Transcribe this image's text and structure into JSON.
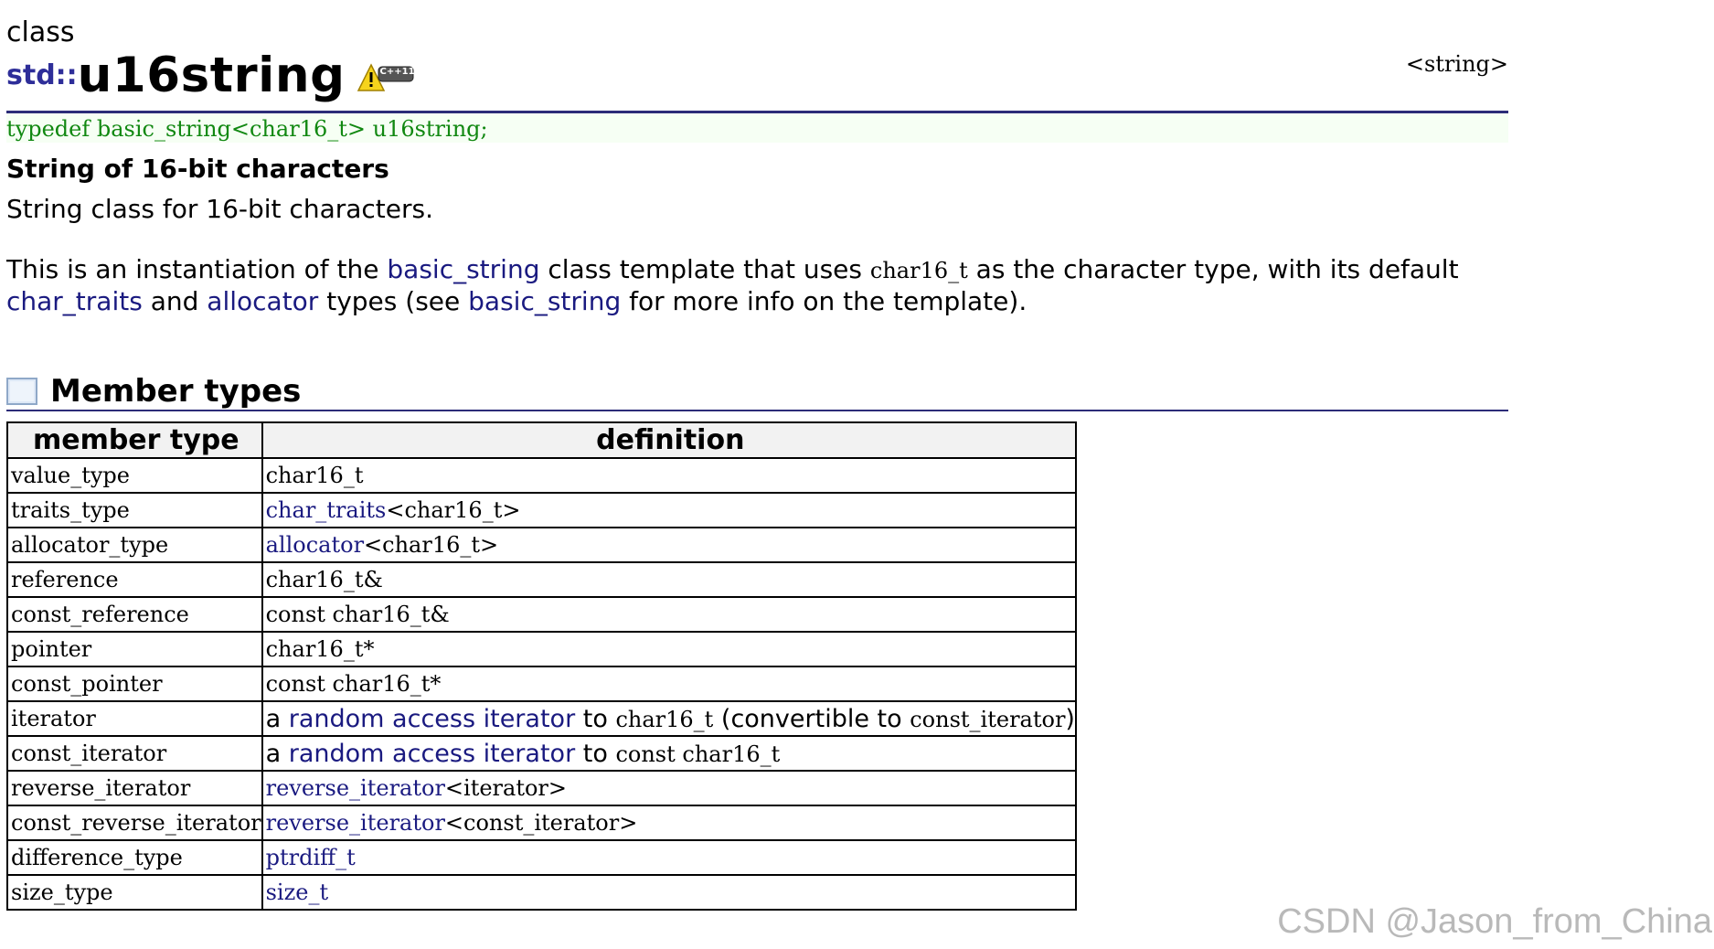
{
  "page": {
    "kind": "class",
    "namespace": "std::",
    "class_name": "u16string",
    "header": "<string>",
    "badge_text": "C++11",
    "typedef": "typedef basic_string<char16_t> u16string;",
    "subtitle": "String of 16-bit characters",
    "summary": "String class for 16-bit characters.",
    "desc": {
      "t1": "This is an instantiation of the ",
      "l1": "basic_string",
      "t2": " class template that uses ",
      "c1": "char16_t",
      "t3": " as the character type, with its default ",
      "l2": "char_traits",
      "t4": " and ",
      "l3": "allocator",
      "t5": " types (see ",
      "l4": "basic_string",
      "t6": " for more info on the template)."
    }
  },
  "section": {
    "title": "Member types",
    "icon": "table-icon"
  },
  "table": {
    "headers": [
      "member type",
      "definition"
    ],
    "rows": [
      {
        "type": "value_type",
        "def": {
          "code": "char16_t"
        }
      },
      {
        "type": "traits_type",
        "def": {
          "link": "char_traits",
          "rest": "<char16_t>"
        }
      },
      {
        "type": "allocator_type",
        "def": {
          "link": "allocator",
          "rest": "<char16_t>"
        }
      },
      {
        "type": "reference",
        "def": {
          "code": "char16_t&"
        }
      },
      {
        "type": "const_reference",
        "def": {
          "code": "const char16_t&"
        }
      },
      {
        "type": "pointer",
        "def": {
          "code": "char16_t*"
        }
      },
      {
        "type": "const_pointer",
        "def": {
          "code": "const char16_t*"
        }
      },
      {
        "type": "iterator",
        "def": {
          "a": "a ",
          "link": "random access iterator",
          "b": " to ",
          "code1": "char16_t",
          "c": " (convertible to ",
          "code2": "const_iterator",
          "d": ")"
        }
      },
      {
        "type": "const_iterator",
        "def": {
          "a": "a ",
          "link": "random access iterator",
          "b": " to ",
          "code1": "const char16_t"
        }
      },
      {
        "type": "reverse_iterator",
        "def": {
          "link": "reverse_iterator",
          "rest": "<iterator>"
        }
      },
      {
        "type": "const_reverse_iterator",
        "def": {
          "link": "reverse_iterator",
          "rest": "<const_iterator>"
        }
      },
      {
        "type": "difference_type",
        "def": {
          "link": "ptrdiff_t"
        }
      },
      {
        "type": "size_type",
        "def": {
          "link": "size_t"
        }
      }
    ]
  },
  "watermark": "CSDN @Jason_from_China",
  "colors": {
    "link": "#1a1a80",
    "rule": "#2c2c78",
    "typedef": "#118811",
    "header_bg": "#f2f2f2"
  }
}
